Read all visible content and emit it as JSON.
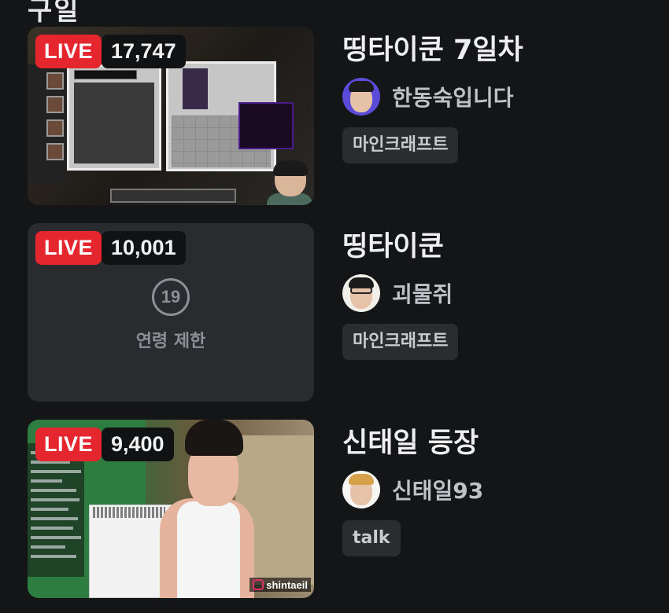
{
  "top_cut_text": "구일",
  "streams": [
    {
      "live_label": "LIVE",
      "viewers": "17,747",
      "title": "띵타이쿤 7일차",
      "channel": "한동숙입니다",
      "category": "마인크래프트"
    },
    {
      "live_label": "LIVE",
      "viewers": "10,001",
      "age_badge": "19",
      "age_text": "연령 제한",
      "title": "띵타이쿤",
      "channel": "괴물쥐",
      "category": "마인크래프트"
    },
    {
      "live_label": "LIVE",
      "viewers": "9,400",
      "watermark": "shintaeil",
      "title": "신태일 등장",
      "channel": "신태일93",
      "category": "talk"
    }
  ],
  "colors": {
    "background": "#141517",
    "live": "#e5262f",
    "tag_bg": "#2a2c30"
  }
}
